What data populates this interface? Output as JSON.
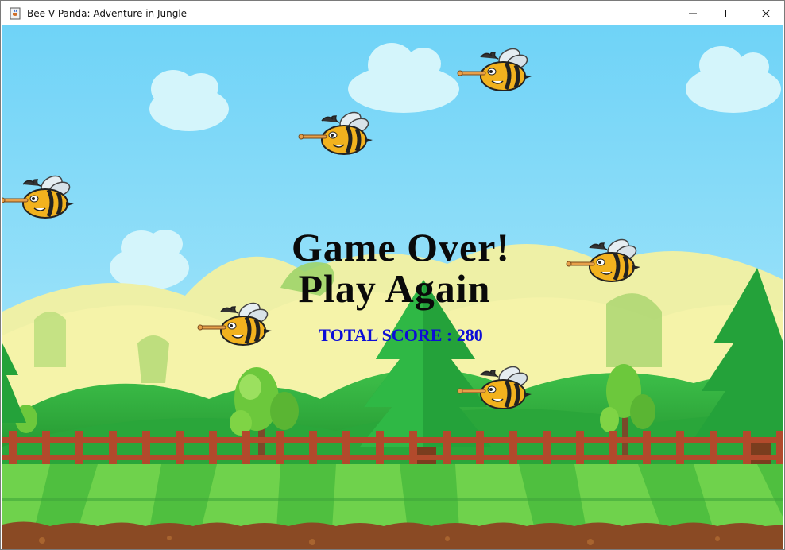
{
  "window": {
    "title": "Bee V Panda: Adventure in Jungle",
    "icons": {
      "app": "java-coffee-icon",
      "minimize": "minimize-icon",
      "maximize": "maximize-icon",
      "close": "close-icon"
    }
  },
  "game": {
    "game_over_text": "Game Over!",
    "play_again_text": "Play Again",
    "score_label": "TOTAL SCORE : ",
    "score_value": "280",
    "colors": {
      "sky": "#7fd6f5",
      "score": "#0d0dd6",
      "fence": "#b24a2c",
      "grass_light": "#7ed957",
      "grass_dark": "#3fa63a",
      "soil": "#8a4a24"
    },
    "sprites": [
      "bee-enemy",
      "cloud",
      "pine-tree",
      "bush-tree",
      "fence"
    ]
  }
}
